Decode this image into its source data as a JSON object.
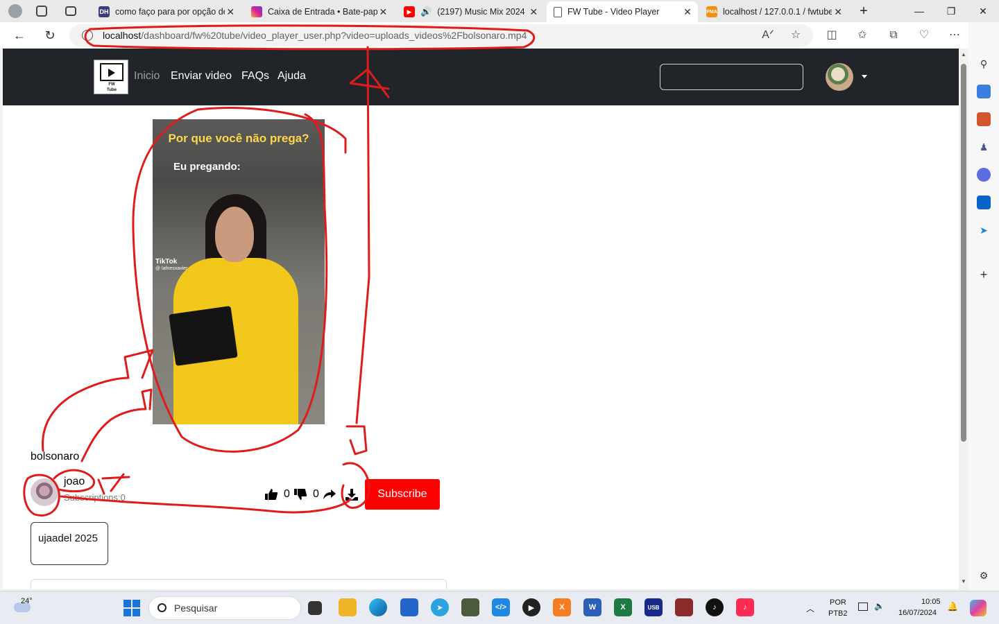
{
  "browser": {
    "tabs": [
      {
        "title": "como faço para por opção de",
        "icon": "dh-favicon"
      },
      {
        "title": "Caixa de Entrada • Bate-papo",
        "icon": "instagram-favicon"
      },
      {
        "title": "(2197) Music Mix 2024 ,",
        "icon": "youtube-favicon"
      },
      {
        "title": "FW Tube - Video Player",
        "icon": "page-favicon",
        "active": true
      },
      {
        "title": "localhost / 127.0.0.1 / fwtube",
        "icon": "phpmyadmin-favicon"
      }
    ],
    "new_tab_label": "+",
    "url_host": "localhost",
    "url_path": "/dashboard/fw%20tube/video_player_user.php?video=uploads_videos%2Fbolsonaro.mp4"
  },
  "site": {
    "logo_text": "FW",
    "logo_subtext": "Tube",
    "nav": [
      "Inicio",
      "Enviar video",
      "FAQs",
      "Ajuda"
    ],
    "search_value": ""
  },
  "video": {
    "caption_top": "Por que você não prega?",
    "caption_sub": "Eu pregando:",
    "watermark": "TikTok",
    "watermark_handle": "@ lafnesxavier",
    "title": "bolsonaro",
    "channel_name": "joao",
    "subscriptions": "Subscriptions:0",
    "likes": "0",
    "dislikes": "0",
    "subscribe_label": "Subscribe",
    "tag": "ujaadel 2025"
  },
  "taskbar": {
    "weather": "24°",
    "search_placeholder": "Pesquisar",
    "lang": "POR",
    "layout": "PTB2",
    "time": "10:05",
    "date": "16/07/2024"
  },
  "colors": {
    "navbar": "#212529",
    "subscribe": "#ff0000",
    "annotation": "#e01b1b",
    "caption_yellow": "#ffd84a"
  }
}
